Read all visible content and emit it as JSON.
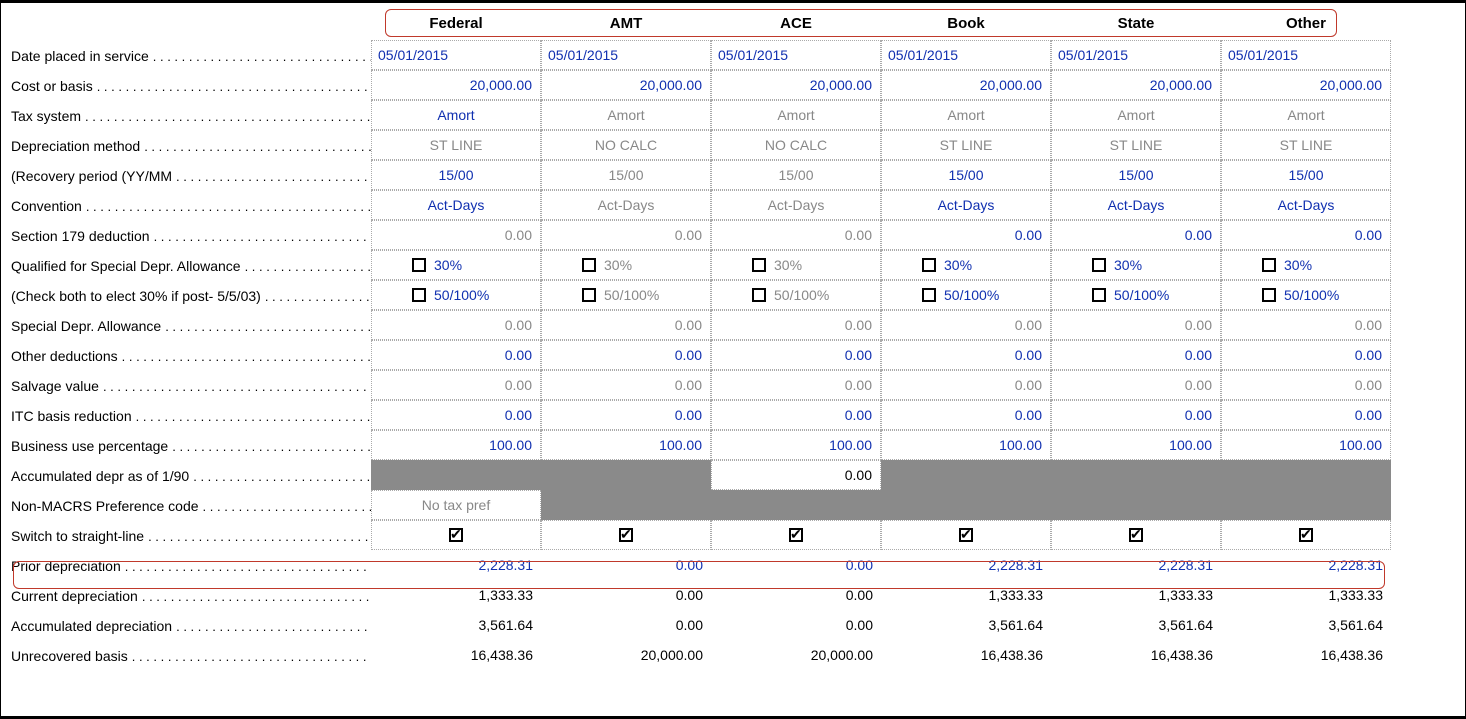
{
  "columns": [
    "Federal",
    "AMT",
    "ACE",
    "Book",
    "State",
    "Other"
  ],
  "rows": {
    "date_placed": {
      "label": "Date placed in service",
      "type": "left",
      "vals": [
        "05/01/2015",
        "05/01/2015",
        "05/01/2015",
        "05/01/2015",
        "05/01/2015",
        "05/01/2015"
      ],
      "colors": [
        "blue",
        "blue",
        "blue",
        "blue",
        "blue",
        "blue"
      ]
    },
    "cost_basis": {
      "label": "Cost or basis",
      "type": "right",
      "vals": [
        "20,000.00",
        "20,000.00",
        "20,000.00",
        "20,000.00",
        "20,000.00",
        "20,000.00"
      ],
      "colors": [
        "blue",
        "blue",
        "blue",
        "blue",
        "blue",
        "blue"
      ]
    },
    "tax_system": {
      "label": "Tax system",
      "type": "center",
      "vals": [
        "Amort",
        "Amort",
        "Amort",
        "Amort",
        "Amort",
        "Amort"
      ],
      "colors": [
        "blue",
        "grey",
        "grey",
        "grey",
        "grey",
        "grey"
      ]
    },
    "dep_method": {
      "label": "Depreciation method",
      "type": "center",
      "vals": [
        "ST LINE",
        "NO CALC",
        "NO CALC",
        "ST LINE",
        "ST LINE",
        "ST LINE"
      ],
      "colors": [
        "grey",
        "grey",
        "grey",
        "grey",
        "grey",
        "grey"
      ]
    },
    "recovery": {
      "label": "(Recovery period (YY/MM",
      "type": "center",
      "vals": [
        "15/00",
        "15/00",
        "15/00",
        "15/00",
        "15/00",
        "15/00"
      ],
      "colors": [
        "blue",
        "grey",
        "grey",
        "blue",
        "blue",
        "blue"
      ]
    },
    "convention": {
      "label": "Convention",
      "type": "center",
      "vals": [
        "Act-Days",
        "Act-Days",
        "Act-Days",
        "Act-Days",
        "Act-Days",
        "Act-Days"
      ],
      "colors": [
        "blue",
        "grey",
        "grey",
        "blue",
        "blue",
        "blue"
      ]
    },
    "sec179": {
      "label": "Section 179 deduction",
      "type": "right",
      "vals": [
        "0.00",
        "0.00",
        "0.00",
        "0.00",
        "0.00",
        "0.00"
      ],
      "colors": [
        "grey",
        "grey",
        "grey",
        "blue",
        "blue",
        "blue"
      ]
    },
    "qual_spec": {
      "label": "Qualified for Special Depr. Allowance",
      "type": "cb",
      "vals": [
        false,
        false,
        false,
        false,
        false,
        false
      ],
      "text": "30%",
      "textcolors": [
        "blue",
        "grey",
        "grey",
        "blue",
        "blue",
        "blue"
      ]
    },
    "check_both": {
      "label": "(Check both to elect 30% if post- 5/5/03)",
      "type": "cb",
      "vals": [
        false,
        false,
        false,
        false,
        false,
        false
      ],
      "text": "50/100%",
      "textcolors": [
        "blue",
        "grey",
        "grey",
        "blue",
        "blue",
        "blue"
      ]
    },
    "spec_allow": {
      "label": "Special Depr. Allowance",
      "type": "right",
      "vals": [
        "0.00",
        "0.00",
        "0.00",
        "0.00",
        "0.00",
        "0.00"
      ],
      "colors": [
        "grey",
        "grey",
        "grey",
        "grey",
        "grey",
        "grey"
      ]
    },
    "other_ded": {
      "label": "Other deductions",
      "type": "right",
      "vals": [
        "0.00",
        "0.00",
        "0.00",
        "0.00",
        "0.00",
        "0.00"
      ],
      "colors": [
        "blue",
        "blue",
        "blue",
        "blue",
        "blue",
        "blue"
      ]
    },
    "salvage": {
      "label": "Salvage value",
      "type": "right",
      "vals": [
        "0.00",
        "0.00",
        "0.00",
        "0.00",
        "0.00",
        "0.00"
      ],
      "colors": [
        "grey",
        "grey",
        "grey",
        "grey",
        "grey",
        "grey"
      ]
    },
    "itc_basis": {
      "label": "ITC basis reduction",
      "type": "right",
      "vals": [
        "0.00",
        "0.00",
        "0.00",
        "0.00",
        "0.00",
        "0.00"
      ],
      "colors": [
        "blue",
        "blue",
        "blue",
        "blue",
        "blue",
        "blue"
      ]
    },
    "bus_use": {
      "label": "Business use percentage",
      "type": "right",
      "vals": [
        "100.00",
        "100.00",
        "100.00",
        "100.00",
        "100.00",
        "100.00"
      ],
      "colors": [
        "blue",
        "blue",
        "blue",
        "blue",
        "blue",
        "blue"
      ]
    },
    "accum_190": {
      "label": "Accumulated depr as of 1/90",
      "type": "accum",
      "vals": [
        "",
        "",
        "0.00",
        "",
        "",
        ""
      ],
      "colors": [
        "",
        "",
        "black",
        "",
        "",
        ""
      ]
    },
    "non_macrs": {
      "label": "Non-MACRS Preference code",
      "type": "nonmacrs",
      "val": "No tax pref"
    },
    "switch_sl": {
      "label": "Switch to straight-line",
      "type": "checkonly",
      "vals": [
        true,
        true,
        true,
        true,
        true,
        true
      ]
    },
    "prior_dep": {
      "label": "Prior depreciation",
      "type": "sumright",
      "vals": [
        "2,228.31",
        "0.00",
        "0.00",
        "2,228.31",
        "2,228.31",
        "2,228.31"
      ],
      "colors": [
        "blue",
        "blue",
        "blue",
        "blue",
        "blue",
        "blue"
      ]
    },
    "curr_dep": {
      "label": "Current depreciation",
      "type": "sumright",
      "vals": [
        "1,333.33",
        "0.00",
        "0.00",
        "1,333.33",
        "1,333.33",
        "1,333.33"
      ],
      "colors": [
        "black",
        "black",
        "black",
        "black",
        "black",
        "black"
      ]
    },
    "accum_dep": {
      "label": "Accumulated depreciation",
      "type": "sumright",
      "vals": [
        "3,561.64",
        "0.00",
        "0.00",
        "3,561.64",
        "3,561.64",
        "3,561.64"
      ],
      "colors": [
        "black",
        "black",
        "black",
        "black",
        "black",
        "black"
      ]
    },
    "unrec_basis": {
      "label": "Unrecovered basis",
      "type": "sumright",
      "vals": [
        "16,438.36",
        "20,000.00",
        "20,000.00",
        "16,438.36",
        "16,438.36",
        "16,438.36"
      ],
      "colors": [
        "black",
        "black",
        "black",
        "black",
        "black",
        "black"
      ]
    }
  },
  "row_order": [
    "date_placed",
    "cost_basis",
    "tax_system",
    "dep_method",
    "recovery",
    "convention",
    "sec179",
    "qual_spec",
    "check_both",
    "spec_allow",
    "other_ded",
    "salvage",
    "itc_basis",
    "bus_use",
    "accum_190",
    "non_macrs",
    "switch_sl",
    "prior_dep",
    "curr_dep",
    "accum_dep",
    "unrec_basis"
  ]
}
